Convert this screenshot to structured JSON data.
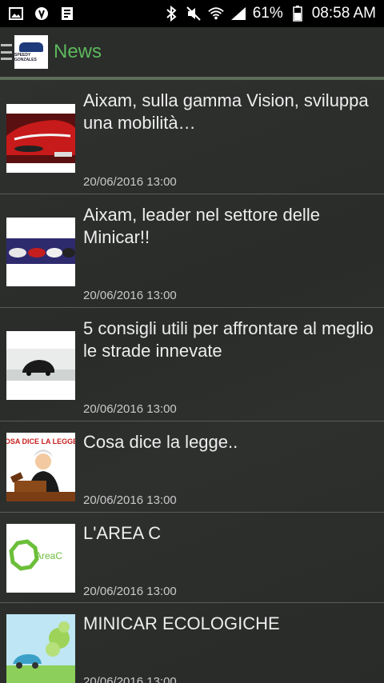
{
  "status_bar": {
    "battery_percent": "61%",
    "time": "08:58 AM",
    "left_icons": [
      "gallery-icon",
      "shield-icon",
      "document-icon"
    ],
    "right_icons": [
      "bluetooth-icon",
      "mute-icon",
      "wifi-icon",
      "signal-icon",
      "battery-icon"
    ]
  },
  "app_bar": {
    "logo_text": "SPEEDY GONZALES",
    "title": "News"
  },
  "news": [
    {
      "title": "Aixam, sulla gamma Vision, sviluppa una mobilità…",
      "date": "20/06/2016 13:00"
    },
    {
      "title": "Aixam, leader nel settore delle Minicar!!",
      "date": "20/06/2016 13:00"
    },
    {
      "title": "5 consigli utili per affrontare al meglio le strade innevate",
      "date": "20/06/2016 13:00"
    },
    {
      "title": "Cosa dice la legge..",
      "date": "20/06/2016 13:00",
      "thumb_text": "COSA DICE LA LEGGE?"
    },
    {
      "title": "L'AREA C",
      "date": "20/06/2016 13:00",
      "thumb_text": "AreaC"
    },
    {
      "title": "MINICAR ECOLOGICHE",
      "date": "20/06/2016 13:00"
    }
  ],
  "colors": {
    "accent": "#5cb85c",
    "background": "#2c2e2c",
    "status_bar": "#000000"
  }
}
